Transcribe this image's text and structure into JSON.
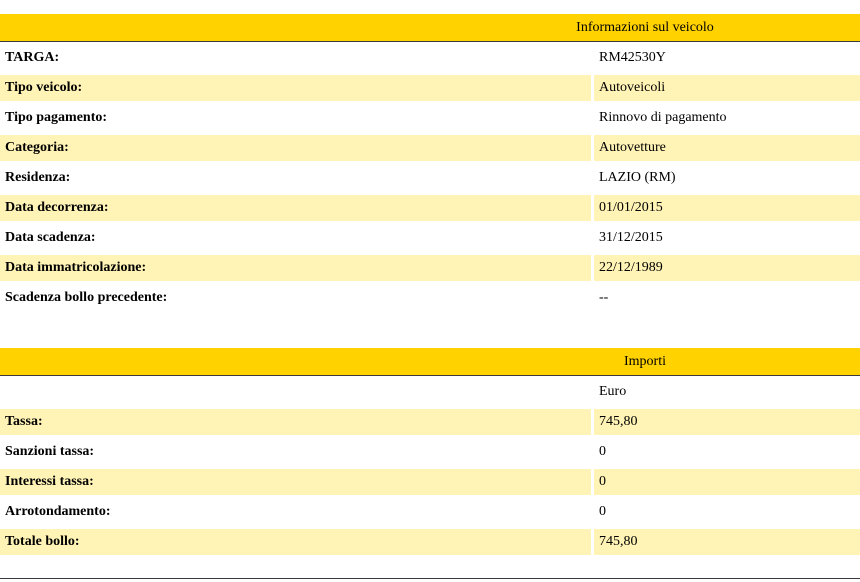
{
  "vehicle_info": {
    "header": "Informazioni sul veicolo",
    "rows": [
      {
        "label": "TARGA:",
        "value": "RM42530Y"
      },
      {
        "label": "Tipo veicolo:",
        "value": "Autoveicoli"
      },
      {
        "label": "Tipo pagamento:",
        "value": "Rinnovo di pagamento"
      },
      {
        "label": "Categoria:",
        "value": "Autovetture"
      },
      {
        "label": "Residenza:",
        "value": "LAZIO (RM)"
      },
      {
        "label": "Data decorrenza:",
        "value": "01/01/2015"
      },
      {
        "label": "Data scadenza:",
        "value": "31/12/2015"
      },
      {
        "label": "Data immatricolazione:",
        "value": "22/12/1989"
      },
      {
        "label": "Scadenza bollo precedente:",
        "value": "--"
      }
    ]
  },
  "amounts": {
    "header": "Importi",
    "currency": "Euro",
    "rows": [
      {
        "label": "Tassa:",
        "value": "745,80"
      },
      {
        "label": "Sanzioni tassa:",
        "value": "0"
      },
      {
        "label": "Interessi tassa:",
        "value": "0"
      },
      {
        "label": "Arrotondamento:",
        "value": "0"
      },
      {
        "label": "Totale bollo:",
        "value": "745,80"
      }
    ]
  },
  "colors": {
    "header_bg": "#FFD200",
    "row_shaded_bg": "#FFF3B5"
  }
}
